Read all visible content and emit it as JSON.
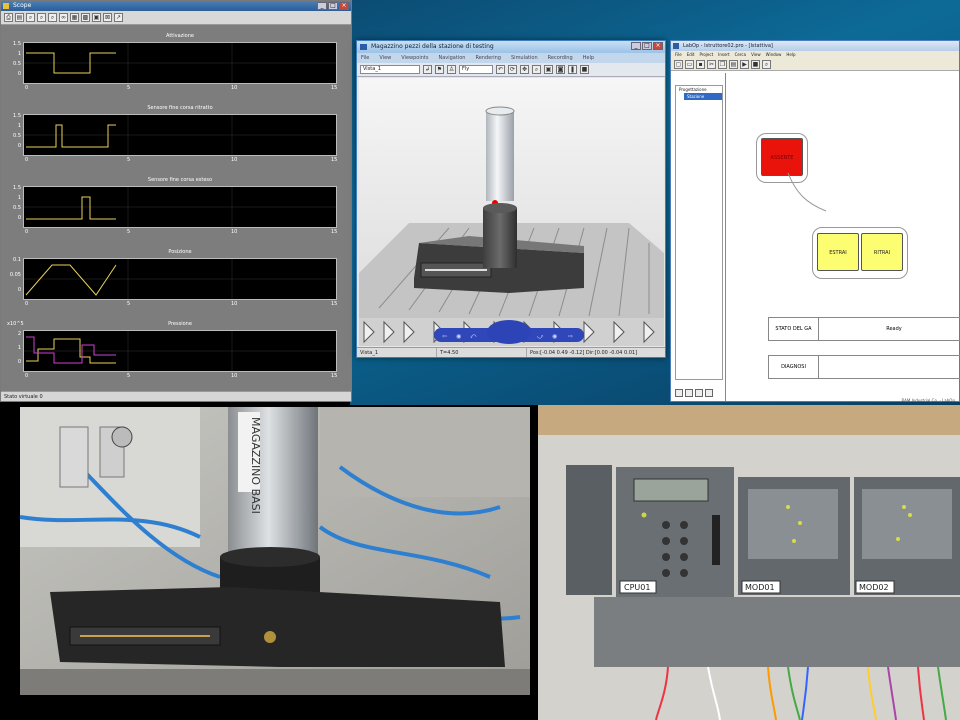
{
  "scope": {
    "title": "Scope",
    "status": "Stato virtuale   0",
    "plots": [
      {
        "title": "Attivazione",
        "yticks": [
          "1.5",
          "1",
          "0.5",
          "0"
        ],
        "xticks": [
          "0",
          "5",
          "10",
          "15"
        ]
      },
      {
        "title": "Sensore fine corsa ritratto",
        "yticks": [
          "1.5",
          "1",
          "0.5",
          "0"
        ],
        "xticks": [
          "0",
          "5",
          "10",
          "15"
        ]
      },
      {
        "title": "Sensore fine corsa esteso",
        "yticks": [
          "1.5",
          "1",
          "0.5",
          "0"
        ],
        "xticks": [
          "0",
          "5",
          "10",
          "15"
        ]
      },
      {
        "title": "Posizione",
        "yticks": [
          "0.1",
          "0.05",
          "0"
        ],
        "xticks": [
          "0",
          "5",
          "10",
          "15"
        ]
      },
      {
        "title": "Pressione",
        "yticks": [
          "x10^5",
          "2",
          "1",
          "0"
        ],
        "xticks": [
          "0",
          "5",
          "10",
          "15"
        ]
      }
    ]
  },
  "viewer": {
    "title": "Magazzino pezzi della stazione di testing",
    "menu": [
      "File",
      "View",
      "Viewpoints",
      "Navigation",
      "Rendering",
      "Simulation",
      "Recording",
      "Help"
    ],
    "view_combo": "Vista_1",
    "mode_combo": "Fly",
    "status_view": "Vista_1",
    "status_time": "T=4.50",
    "status_pos": "Pos:[-0.04 0.49 -0.12]  Dir:[0.00 -0.04 0.01]"
  },
  "editor": {
    "title": "LabOp - Istruttore02.pro - [Istattiva]",
    "menu": [
      "File",
      "Edit",
      "Project",
      "Insert",
      "Cerca",
      "View",
      "Window",
      "Help"
    ],
    "tree_root": "Progettazione",
    "tree_item": "Stazione",
    "step_red": "ASSENTE",
    "step_1": "ESTRAI",
    "step_2": "RITRAI",
    "row1_label": "STATO DEL GA",
    "row1_value": "Ready",
    "row2_label": "DIAGNOSI",
    "row2_value": "",
    "footer": "RAM Industrial Co. - LabOp"
  },
  "photo_left": {
    "label": "MAGAZZINO BASI"
  },
  "photo_right": {
    "labels": [
      "CPU01",
      "MOD01",
      "MOD02"
    ]
  },
  "colors": {
    "desktop": "#0d6a97",
    "scope_bg": "#7d7d7d",
    "trace_yellow": "#e8d05a",
    "trace_magenta": "#d040d0",
    "step_red": "#e9130c",
    "step_yellow": "#fdfd72"
  }
}
